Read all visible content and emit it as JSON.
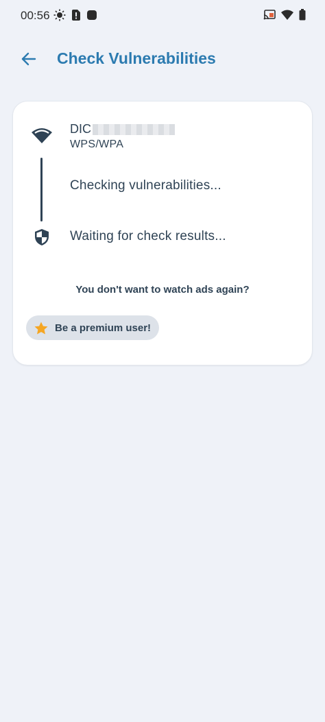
{
  "status_bar": {
    "time": "00:56",
    "left_icons": [
      "brightness-icon",
      "sim-alert-icon",
      "app-notification-icon"
    ],
    "right_icons": [
      "cast-icon",
      "wifi-signal-icon",
      "battery-icon"
    ]
  },
  "app_bar": {
    "back_icon": "arrow-left-icon",
    "title": "Check Vulnerabilities"
  },
  "network": {
    "name_visible_prefix": "DIC",
    "security": "WPS/WPA",
    "icon": "wifi-icon"
  },
  "steps": {
    "checking": "Checking vulnerabilities...",
    "waiting": "Waiting for check results...",
    "waiting_icon": "shield-icon"
  },
  "promo": {
    "question": "You don't want to watch ads again?",
    "button_label": "Be a premium user!",
    "button_icon": "star-icon"
  },
  "colors": {
    "accent": "#2c7bb0",
    "background": "#eff2f8",
    "card": "#ffffff",
    "text": "#2f4355",
    "star": "#f5a623",
    "button_bg": "#dde2e9"
  }
}
